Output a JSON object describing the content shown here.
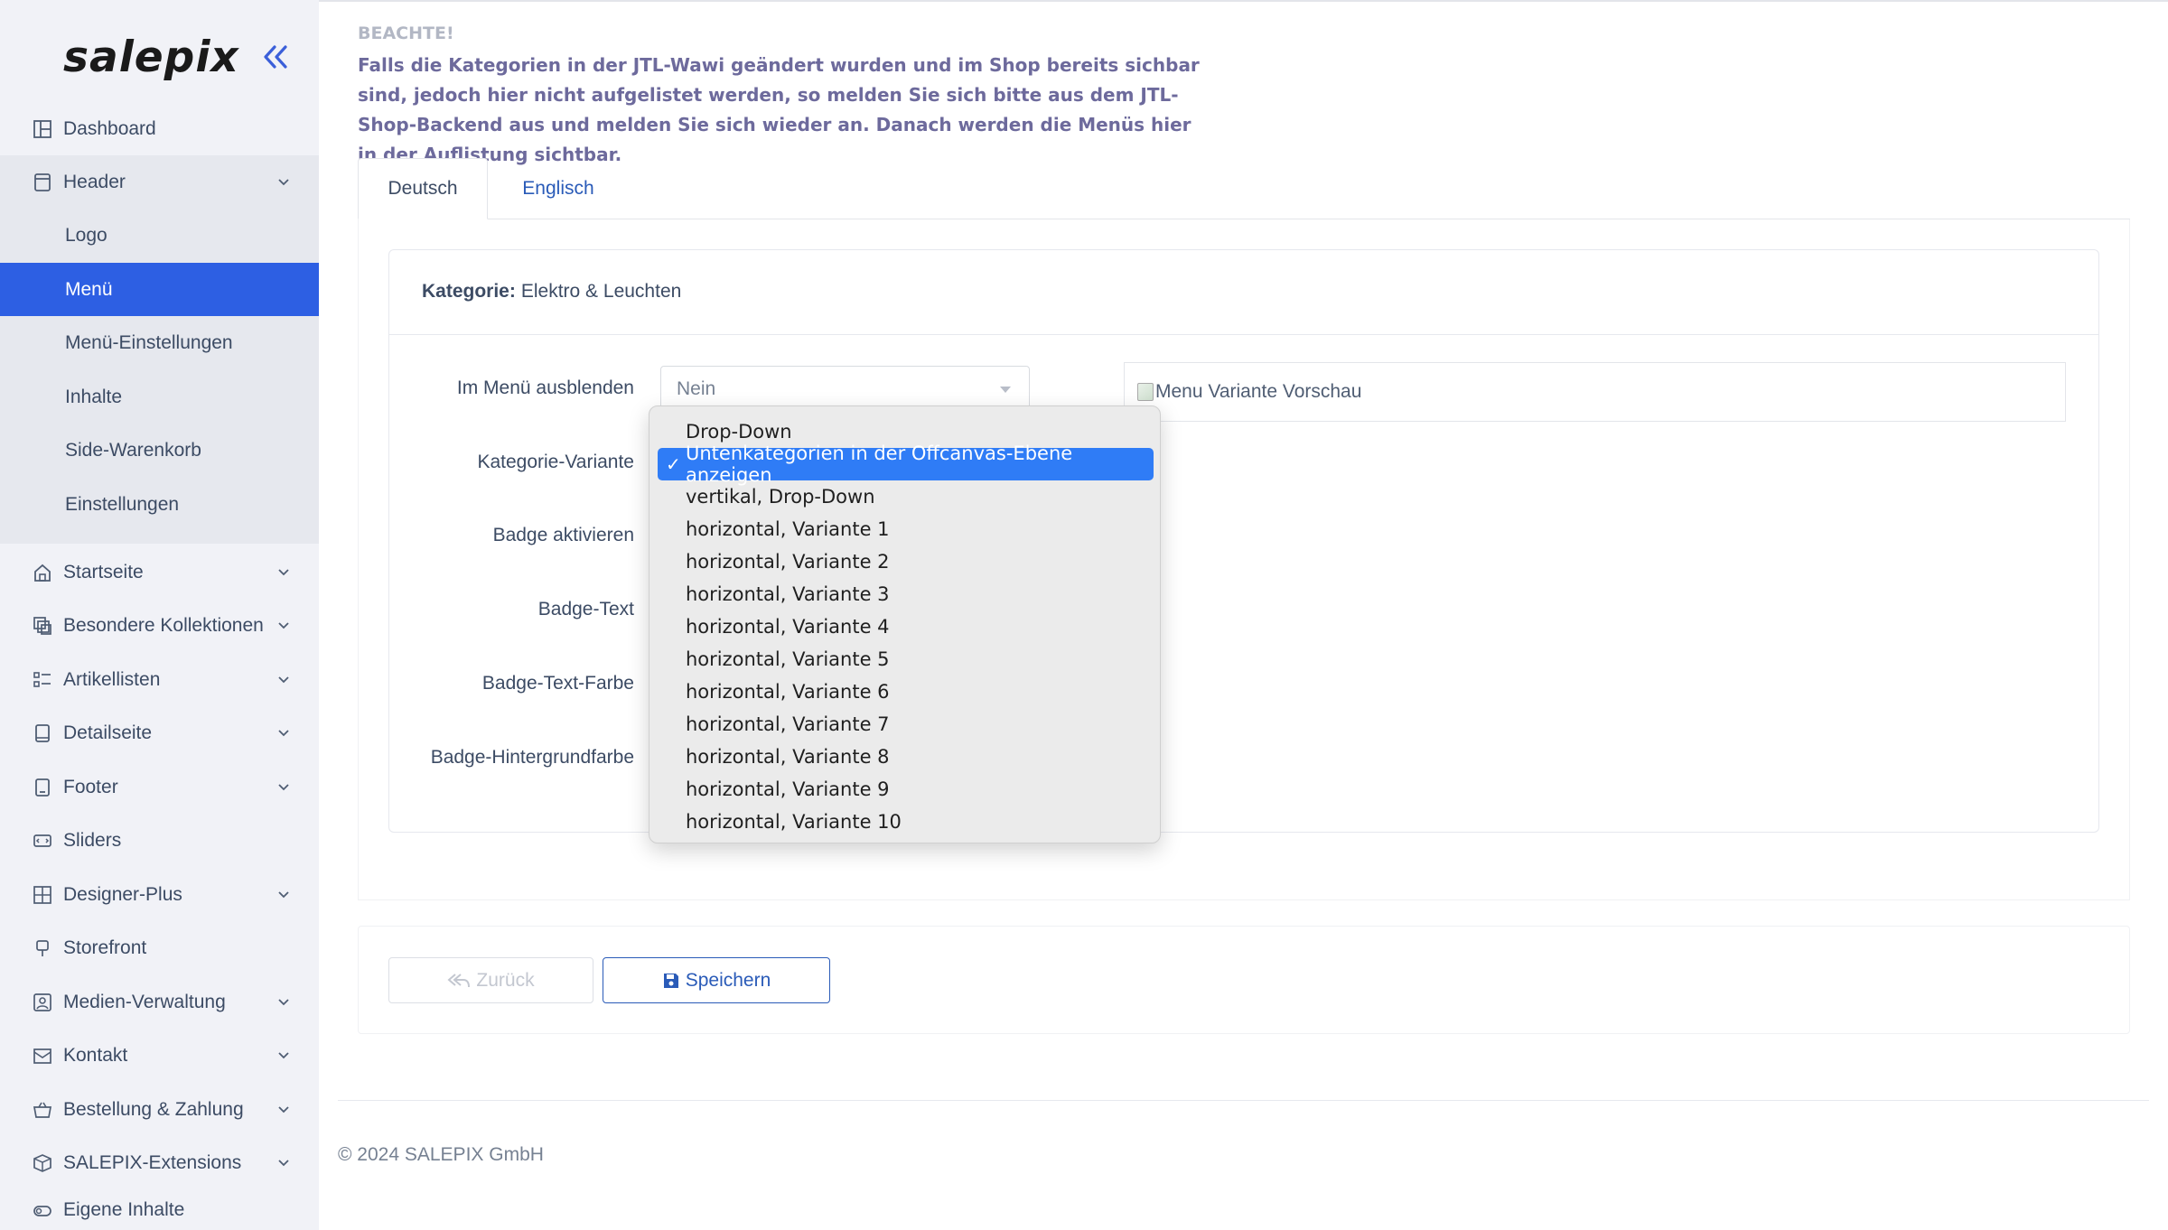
{
  "sidebar": {
    "brand": "salepix",
    "items": [
      {
        "label": "Dashboard",
        "icon": "dashboard-icon"
      },
      {
        "label": "Header",
        "icon": "header-icon"
      },
      {
        "label": "Startseite",
        "icon": "home-icon"
      },
      {
        "label": "Besondere Kollektionen",
        "icon": "collections-icon"
      },
      {
        "label": "Artikellisten",
        "icon": "list-icon"
      },
      {
        "label": "Detailseite",
        "icon": "page-icon"
      },
      {
        "label": "Footer",
        "icon": "footer-icon"
      },
      {
        "label": "Sliders",
        "icon": "slider-icon"
      },
      {
        "label": "Designer-Plus",
        "icon": "designer-icon"
      },
      {
        "label": "Storefront",
        "icon": "storefront-icon"
      },
      {
        "label": "Medien-Verwaltung",
        "icon": "media-icon"
      },
      {
        "label": "Kontakt",
        "icon": "contact-icon"
      },
      {
        "label": "Bestellung & Zahlung",
        "icon": "basket-icon"
      },
      {
        "label": "SALEPIX-Extensions",
        "icon": "box-icon"
      },
      {
        "label": "Eigene Inhalte",
        "icon": "toggle-icon"
      }
    ],
    "header_sub": [
      "Logo",
      "Menü",
      "Menü-Einstellungen",
      "Inhalte",
      "Side-Warenkorb",
      "Einstellungen"
    ]
  },
  "notice": {
    "title": "BEACHTE!",
    "text": "Falls die Kategorien in der JTL-Wawi geändert wurden und im Shop bereits sichbar sind, jedoch hier nicht aufgelistet werden, so melden Sie sich bitte aus dem JTL-Shop-Backend aus und melden Sie sich wieder an. Danach werden die Menüs hier in der Auflistung sichtbar."
  },
  "tabs": [
    "Deutsch",
    "Englisch"
  ],
  "card": {
    "category_label": "Kategorie:",
    "category_value": "Elektro & Leuchten"
  },
  "form": {
    "labels": [
      "Im Menü ausblenden",
      "Kategorie-Variante",
      "Badge aktivieren",
      "Badge-Text",
      "Badge-Text-Farbe",
      "Badge-Hintergrundfarbe"
    ],
    "hide_value": "Nein",
    "preview_alt": "Menu Variante Vorschau"
  },
  "dropdown": {
    "options": [
      "Drop-Down",
      "Untenkategorien in der Offcanvas-Ebene anzeigen",
      "vertikal, Drop-Down",
      "horizontal, Variante 1",
      "horizontal, Variante 2",
      "horizontal, Variante 3",
      "horizontal, Variante 4",
      "horizontal, Variante 5",
      "horizontal, Variante 6",
      "horizontal, Variante 7",
      "horizontal, Variante 8",
      "horizontal, Variante 9",
      "horizontal, Variante 10"
    ],
    "check": "✓"
  },
  "buttons": {
    "back": "Zurück",
    "save": "Speichern"
  },
  "footer": {
    "copyright": "© 2024 SALEPIX GmbH"
  },
  "colors": {
    "accent": "#2d5fe3",
    "dropdown_selected": "#2f7cf6",
    "notice_text": "#6d6a9c",
    "link": "#2a5bb8"
  }
}
